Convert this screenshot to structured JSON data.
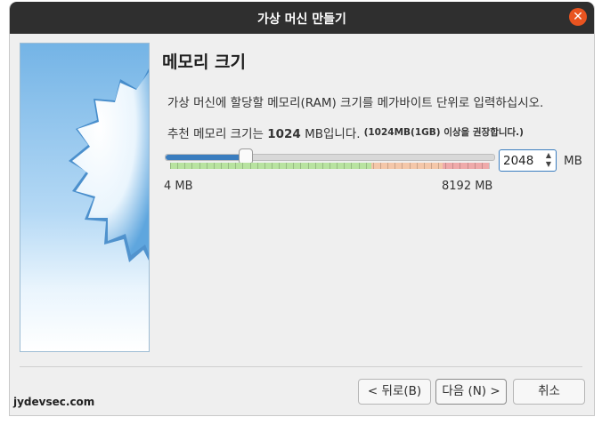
{
  "window": {
    "title": "가상 머신 만들기",
    "close_icon": "close-icon"
  },
  "page": {
    "heading": "메모리 크기",
    "description": "가상 머신에 할당할 메모리(RAM) 크기를 메가바이트 단위로 입력하십시오.",
    "recommend_prefix": "추천 메모리 크기는 ",
    "recommend_value": "1024",
    "recommend_suffix": " MB입니다.",
    "recommend_note": "(1024MB(1GB) 이상을 권장합니다.)"
  },
  "memory": {
    "value": "2048",
    "unit": "MB",
    "min_label": "4 MB",
    "max_label": "8192 MB",
    "min_value": 4,
    "max_value": 8192,
    "current_value": 2048,
    "colors": {
      "accent": "#3a7dbf",
      "safe": "#b8e3a0",
      "warning": "#f4c7a9",
      "danger": "#efaaaa"
    }
  },
  "buttons": {
    "back_label": "< 뒤로(B)",
    "next_label": "다음 (N) >",
    "cancel_label": "취소"
  },
  "watermark": "jydevsec.com"
}
